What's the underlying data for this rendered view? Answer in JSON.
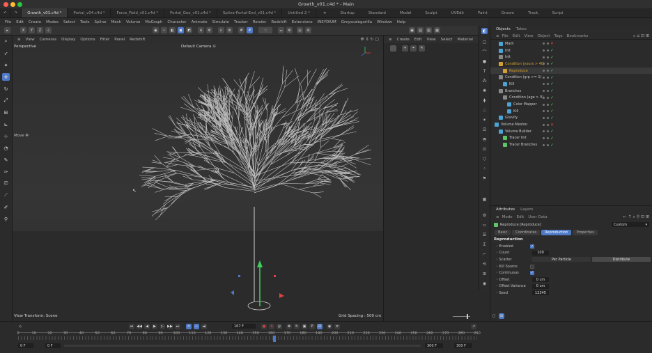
{
  "window": {
    "title": "Growth_v01.c4d * - Main"
  },
  "doc_tabs": [
    {
      "label": "Growth_v01.c4d *",
      "active": true
    },
    {
      "label": "Portal_v04.c4d *",
      "active": false
    },
    {
      "label": "Force_Field_v01.c4d *",
      "active": false
    },
    {
      "label": "Portal_Geo_v01.c4d *",
      "active": false
    },
    {
      "label": "Spline-Portal-End_v01.c4d *",
      "active": false
    },
    {
      "label": "Untitled 2 *",
      "active": false
    }
  ],
  "layout_tabs": [
    "Startup",
    "Standard",
    "Model",
    "Sculpt",
    "UVEdit",
    "Paint",
    "Groom",
    "Track",
    "Script"
  ],
  "add_tab": "+",
  "menus": [
    "File",
    "Edit",
    "Create",
    "Modes",
    "Select",
    "Tools",
    "Spline",
    "Mesh",
    "Volume",
    "MoGraph",
    "Character",
    "Animate",
    "Simulate",
    "Tracker",
    "Render",
    "Redshift",
    "Extensions",
    "INSYDIUM",
    "Greyscalegorilla",
    "Window",
    "Help"
  ],
  "toolbar_axes": [
    "X",
    "Y",
    "Z"
  ],
  "viewport": {
    "menus": [
      "View",
      "Cameras",
      "Display",
      "Options",
      "Filter",
      "Panel",
      "Redshift"
    ],
    "projection": "Perspective",
    "camera": "Default Camera",
    "camera_icon": "camera-icon",
    "view_transform": "View Transform: Scene",
    "grid_spacing": "Grid Spacing : 500 cm",
    "move_label": "Move"
  },
  "mid_panel_menus": [
    "Create",
    "Edit",
    "View",
    "Select",
    "Material"
  ],
  "objects_panel": {
    "tabs": [
      "Objects",
      "Takes"
    ],
    "menus": [
      "File",
      "Edit",
      "View",
      "Object",
      "Tags",
      "Bookmarks"
    ],
    "rows": [
      {
        "label": "Math",
        "depth": 1,
        "color": "#4da3d6",
        "check": "x"
      },
      {
        "label": "Init",
        "depth": 1,
        "color": "#4da3d6",
        "check": "v"
      },
      {
        "label": "Init",
        "depth": 1,
        "color": "#888888",
        "check": "v"
      },
      {
        "label": "Condition (yours > 40)",
        "depth": 1,
        "color": "#d6a030",
        "check": "v",
        "highlight": true
      },
      {
        "label": "Reproduce",
        "depth": 2,
        "color": "#d6a030",
        "check": "v",
        "selected": true
      },
      {
        "label": "Condition (grp >= 1)",
        "depth": 1,
        "color": "#888888",
        "check": "v"
      },
      {
        "label": "Kill",
        "depth": 2,
        "color": "#4da3d6",
        "check": "v"
      },
      {
        "label": "Branches",
        "depth": 1,
        "color": "#888888",
        "check": "v"
      },
      {
        "label": "Condition (age > 0)",
        "depth": 2,
        "color": "#888888",
        "check": "v"
      },
      {
        "label": "Color Mapper",
        "depth": 3,
        "color": "#4da3d6",
        "check": "v"
      },
      {
        "label": "Kill",
        "depth": 3,
        "color": "#4da3d6",
        "check": "v"
      },
      {
        "label": "Gravity",
        "depth": 1,
        "color": "#4da3d6",
        "check": "v"
      },
      {
        "label": "Volume Mesher",
        "depth": 0,
        "color": "#4da3d6",
        "check": "x"
      },
      {
        "label": "Volume Builder",
        "depth": 1,
        "color": "#4da3d6",
        "check": "v"
      },
      {
        "label": "Tracer Init",
        "depth": 2,
        "color": "#5cc46a",
        "check": "v"
      },
      {
        "label": "Tracer Branches",
        "depth": 2,
        "color": "#5cc46a",
        "check": "v"
      }
    ]
  },
  "attributes_panel": {
    "tabs": [
      "Attributes",
      "Layers"
    ],
    "menus": [
      "Mode",
      "Edit",
      "User Data"
    ],
    "object_name": "Reproduce [Reproduce]",
    "preset": "Custom",
    "subtabs": [
      {
        "label": "Basic",
        "active": false
      },
      {
        "label": "Coordinates",
        "active": false
      },
      {
        "label": "Reproduction",
        "active": true
      },
      {
        "label": "Properties",
        "active": false
      }
    ],
    "section": "Reproduction",
    "fields": {
      "enabled": {
        "label": "Enabled",
        "checked": true
      },
      "count": {
        "label": "Count",
        "value": "100"
      },
      "scatter": {
        "label": "Scatter",
        "option_a": "Per Particle",
        "option_b": "Distribute"
      },
      "kill_source": {
        "label": "Kill Source",
        "checked": false
      },
      "continuous": {
        "label": "Continuous",
        "checked": true
      },
      "offset": {
        "label": "Offset",
        "value": "0 cm"
      },
      "offset_variance": {
        "label": "Offset Variance",
        "value": "0 cm"
      },
      "seed": {
        "label": "Seed",
        "value": "12345"
      }
    }
  },
  "timeline": {
    "current_frame": "167 F",
    "ticks": [
      "0",
      "10",
      "20",
      "30",
      "40",
      "50",
      "60",
      "70",
      "80",
      "90",
      "100",
      "110",
      "120",
      "130",
      "140",
      "150",
      "160",
      "170",
      "180",
      "190",
      "200",
      "210",
      "220",
      "230",
      "240",
      "250",
      "260",
      "270",
      "280",
      "290"
    ],
    "start": "0 F",
    "start2": "0 F",
    "end": "300 F",
    "end2": "300 F"
  },
  "colors": {
    "accent": "#4d79c7",
    "object_highlight": "#d6a030",
    "check_green": "#3fcf5a",
    "check_red": "#e04040"
  }
}
